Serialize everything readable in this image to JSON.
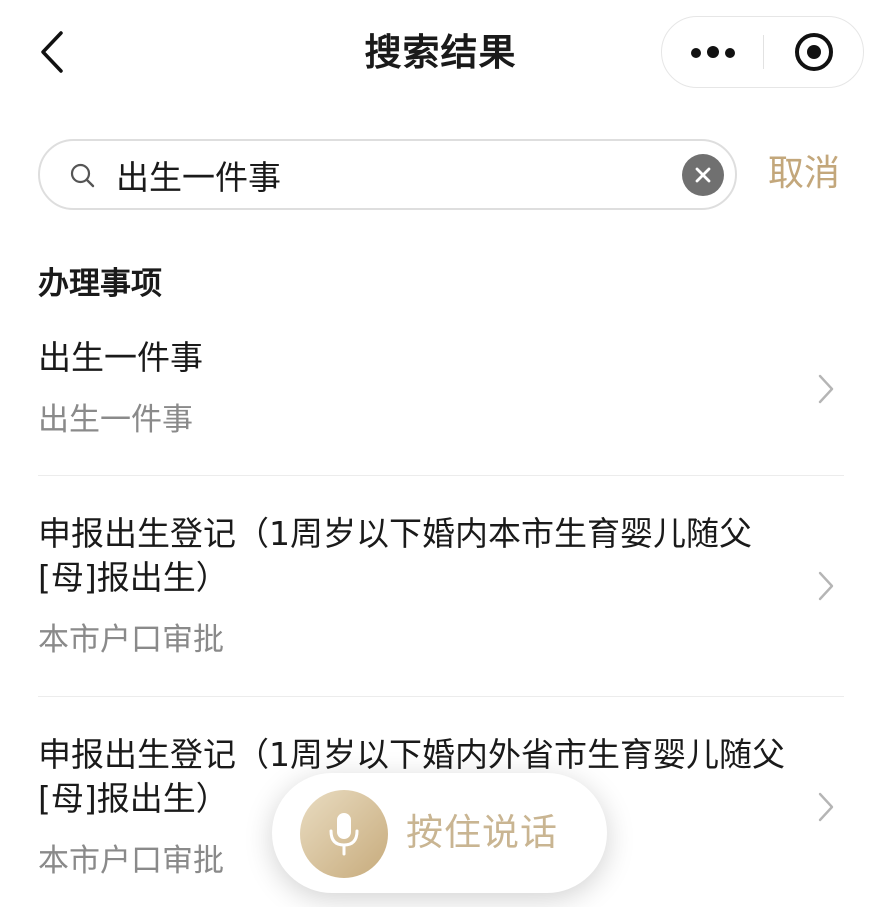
{
  "header": {
    "title": "搜索结果",
    "back_icon": "chevron-left-icon",
    "more_icon": "more-dots-icon",
    "close_icon": "target-circle-icon"
  },
  "search": {
    "value": "出生一件事",
    "placeholder": "",
    "cancel_label": "取消"
  },
  "section": {
    "title": "办理事项"
  },
  "results": [
    {
      "name_lines": [
        "出生一件事"
      ],
      "category": "出生一件事"
    },
    {
      "name_lines": [
        "申报出生登记（1周岁以下婚内本市生育婴儿随父",
        "[母]报出生）"
      ],
      "category": "本市户口审批"
    },
    {
      "name_lines": [
        "申报出生登记（1周岁以下婚内外省市生育婴儿随父",
        "[母]报出生）"
      ],
      "category": "本市户口审批"
    }
  ],
  "voice": {
    "label": "按住说话",
    "icon": "microphone-icon"
  },
  "colors": {
    "accent_gold": "#c3a77b",
    "secondary_text": "#8a8a8a",
    "clear_button": "#707070"
  }
}
